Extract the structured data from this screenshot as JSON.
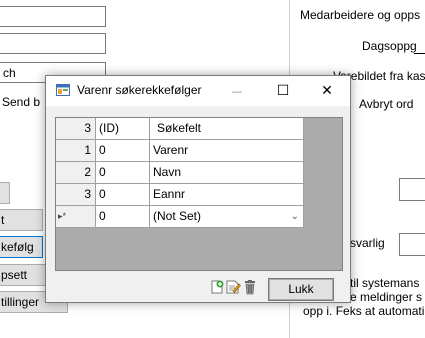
{
  "background": {
    "top_label": "Medarbeidere og opps",
    "dagsopp_label": "Dagsoppg",
    "varebildet_label": "Varebildet fra kas",
    "avbryt_label": "Avbryt ord",
    "combo_value": "ch",
    "send_label": "Send b",
    "btn_partial_1": "t",
    "btn_sokefolge": "kefølg",
    "btn_oppsett": "psett",
    "btn_innstillinger": "tillinger",
    "ansvarlig_label": "svarlig",
    "info_line_1": "til systemans",
    "info_line_2": "e meldinger s",
    "info_line_3": "opp i. Feks at automati"
  },
  "dialog": {
    "title": "Varenr søkerekkefølger",
    "minimize_glyph": "—",
    "maximize_glyph": "☐",
    "close_glyph": "✕",
    "grid": {
      "header": {
        "row_header": "3",
        "id": "(ID)",
        "field": "Søkefelt"
      },
      "rows": [
        {
          "row_header": "1",
          "id": "0",
          "field": "Varenr"
        },
        {
          "row_header": "2",
          "id": "0",
          "field": "Navn"
        },
        {
          "row_header": "3",
          "id": "0",
          "field": "Eannr"
        }
      ],
      "new_row": {
        "marker": "▸*",
        "id": "0",
        "field": "(Not Set)"
      }
    },
    "close_button_label": "Lukk"
  },
  "colors": {
    "focus_border": "#0078d7",
    "dialog_bg": "#f0f0f0",
    "grid_bg": "#ababab"
  }
}
